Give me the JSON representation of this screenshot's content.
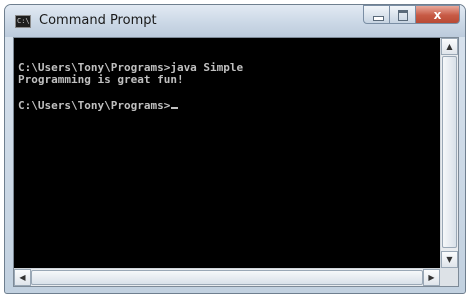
{
  "window": {
    "title": "Command Prompt",
    "icon": "command-prompt-icon",
    "icon_text": "C:\\",
    "controls": {
      "minimize": "minimize-icon",
      "maximize": "maximize-icon",
      "close": "close-icon",
      "close_glyph": "x"
    }
  },
  "console": {
    "lines": [
      "C:\\Users\\Tony\\Programs>java Simple",
      "Programming is great fun!",
      "",
      "C:\\Users\\Tony\\Programs>"
    ],
    "text_color": "#c0c0c0",
    "background_color": "#000000"
  },
  "scrollbars": {
    "vertical": {
      "up_glyph": "▲",
      "down_glyph": "▼"
    },
    "horizontal": {
      "left_glyph": "◀",
      "right_glyph": "▶"
    }
  }
}
